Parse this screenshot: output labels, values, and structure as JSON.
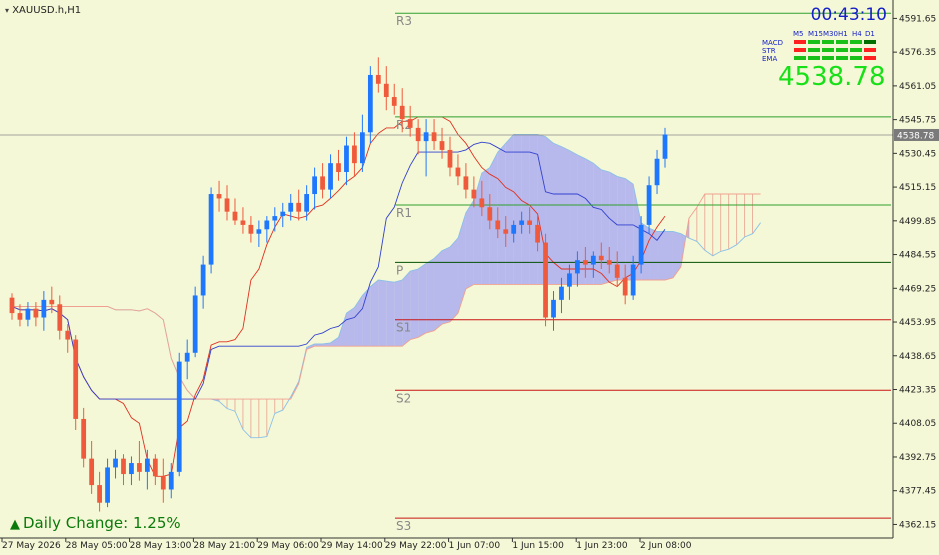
{
  "header": {
    "symbol_label": "XAUUSD.h,H1",
    "timer": "00:43:10",
    "current_price": "4538.78",
    "price_tag": "4538.78"
  },
  "daily_change": {
    "label": "Daily Change:",
    "value": "1.25%"
  },
  "signal_panel": {
    "timeframes": [
      "M5",
      "M15",
      "M30",
      "H1",
      "H4",
      "D1"
    ],
    "rows": [
      {
        "name": "MACD",
        "cells": [
          "#ff2020",
          "#18c018",
          "#18c018",
          "#18c018",
          "#18c018",
          "#007000"
        ]
      },
      {
        "name": "STR",
        "cells": [
          "#ff2020",
          "#18c018",
          "#18c018",
          "#18c018",
          "#18c018",
          "#ff2020"
        ]
      },
      {
        "name": "EMA",
        "cells": [
          "#18c018",
          "#18c018",
          "#18c018",
          "#18c018",
          "#18c018",
          "#ff2020"
        ]
      }
    ]
  },
  "pivots": [
    {
      "name": "R3",
      "price": 4594,
      "color": "#2ea02e"
    },
    {
      "name": "R2",
      "price": 4547,
      "color": "#2ea02e"
    },
    {
      "name": "R1",
      "price": 4507,
      "color": "#2ea02e"
    },
    {
      "name": "P",
      "price": 4481,
      "color": "#005000"
    },
    {
      "name": "S1",
      "price": 4455,
      "color": "#c81414"
    },
    {
      "name": "S2",
      "price": 4423,
      "color": "#c81414"
    },
    {
      "name": "S3",
      "price": 4365,
      "color": "#c81414"
    }
  ],
  "price_axis_ticks": [
    "4591.65",
    "4576.35",
    "4561.05",
    "4545.75",
    "4530.45",
    "4515.15",
    "4499.85",
    "4484.55",
    "4469.25",
    "4453.95",
    "4438.65",
    "4423.35",
    "4408.05",
    "4392.75",
    "4377.45",
    "4362.15"
  ],
  "time_axis_labels": [
    "27 May 2026",
    "28 May 05:00",
    "28 May 13:00",
    "28 May 21:00",
    "29 May 06:00",
    "29 May 14:00",
    "29 May 22:00",
    "1 Jun 07:00",
    "1 Jun 15:00",
    "1 Jun 23:00",
    "2 Jun 08:00"
  ],
  "colors": {
    "bull": "#1e78ff",
    "bear": "#f05a3c",
    "cloud": "#a8a8f0",
    "background": "#f5f8d6"
  },
  "chart_data": {
    "type": "candlestick",
    "ylim": [
      4356,
      4600
    ],
    "current": 4538.78,
    "candles": [
      [
        4465,
        4467,
        4455,
        4458
      ],
      [
        4458,
        4462,
        4452,
        4455
      ],
      [
        4455,
        4463,
        4452,
        4460
      ],
      [
        4460,
        4463,
        4452,
        4456
      ],
      [
        4456,
        4468,
        4450,
        4464
      ],
      [
        4464,
        4470,
        4458,
        4462
      ],
      [
        4462,
        4466,
        4446,
        4450
      ],
      [
        4450,
        4453,
        4440,
        4446
      ],
      [
        4446,
        4448,
        4405,
        4410
      ],
      [
        4410,
        4415,
        4388,
        4392
      ],
      [
        4392,
        4400,
        4376,
        4380
      ],
      [
        4380,
        4386,
        4368,
        4372
      ],
      [
        4372,
        4392,
        4370,
        4388
      ],
      [
        4388,
        4396,
        4383,
        4392
      ],
      [
        4392,
        4394,
        4380,
        4385
      ],
      [
        4385,
        4393,
        4380,
        4390
      ],
      [
        4390,
        4400,
        4382,
        4386
      ],
      [
        4386,
        4396,
        4378,
        4392
      ],
      [
        4392,
        4394,
        4380,
        4384
      ],
      [
        4384,
        4392,
        4372,
        4378
      ],
      [
        4378,
        4390,
        4374,
        4386
      ],
      [
        4386,
        4440,
        4384,
        4436
      ],
      [
        4436,
        4446,
        4428,
        4440
      ],
      [
        4440,
        4470,
        4438,
        4466
      ],
      [
        4466,
        4484,
        4460,
        4480
      ],
      [
        4480,
        4515,
        4476,
        4512
      ],
      [
        4512,
        4518,
        4504,
        4510
      ],
      [
        4510,
        4516,
        4500,
        4504
      ],
      [
        4504,
        4510,
        4498,
        4500
      ],
      [
        4500,
        4506,
        4494,
        4498
      ],
      [
        4498,
        4502,
        4490,
        4494
      ],
      [
        4494,
        4500,
        4488,
        4496
      ],
      [
        4496,
        4502,
        4490,
        4500
      ],
      [
        4500,
        4506,
        4495,
        4502
      ],
      [
        4502,
        4508,
        4497,
        4504
      ],
      [
        4504,
        4512,
        4500,
        4508
      ],
      [
        4508,
        4514,
        4500,
        4504
      ],
      [
        4504,
        4516,
        4500,
        4512
      ],
      [
        4512,
        4524,
        4505,
        4520
      ],
      [
        4520,
        4526,
        4510,
        4514
      ],
      [
        4514,
        4530,
        4510,
        4526
      ],
      [
        4526,
        4532,
        4518,
        4522
      ],
      [
        4522,
        4538,
        4516,
        4534
      ],
      [
        4534,
        4540,
        4520,
        4526
      ],
      [
        4526,
        4548,
        4522,
        4540
      ],
      [
        4540,
        4570,
        4535,
        4566
      ],
      [
        4566,
        4574,
        4558,
        4562
      ],
      [
        4562,
        4570,
        4550,
        4556
      ],
      [
        4556,
        4562,
        4548,
        4552
      ],
      [
        4552,
        4560,
        4540,
        4546
      ],
      [
        4546,
        4552,
        4538,
        4542
      ],
      [
        4542,
        4546,
        4530,
        4536
      ],
      [
        4536,
        4546,
        4520,
        4540
      ],
      [
        4540,
        4546,
        4532,
        4536
      ],
      [
        4536,
        4542,
        4528,
        4532
      ],
      [
        4532,
        4538,
        4520,
        4524
      ],
      [
        4524,
        4530,
        4516,
        4520
      ],
      [
        4520,
        4526,
        4510,
        4514
      ],
      [
        4514,
        4520,
        4506,
        4510
      ],
      [
        4510,
        4518,
        4502,
        4506
      ],
      [
        4506,
        4512,
        4496,
        4500
      ],
      [
        4500,
        4506,
        4492,
        4496
      ],
      [
        4496,
        4502,
        4488,
        4494
      ],
      [
        4494,
        4500,
        4490,
        4498
      ],
      [
        4498,
        4504,
        4494,
        4500
      ],
      [
        4500,
        4506,
        4494,
        4498
      ],
      [
        4498,
        4502,
        4486,
        4490
      ],
      [
        4490,
        4494,
        4452,
        4456
      ],
      [
        4456,
        4468,
        4450,
        4464
      ],
      [
        4464,
        4474,
        4458,
        4470
      ],
      [
        4470,
        4480,
        4464,
        4476
      ],
      [
        4476,
        4486,
        4470,
        4482
      ],
      [
        4482,
        4488,
        4474,
        4480
      ],
      [
        4480,
        4486,
        4474,
        4484
      ],
      [
        4484,
        4490,
        4478,
        4482
      ],
      [
        4482,
        4488,
        4476,
        4480
      ],
      [
        4480,
        4486,
        4470,
        4474
      ],
      [
        4474,
        4480,
        4462,
        4466
      ],
      [
        4466,
        4484,
        4464,
        4480
      ],
      [
        4480,
        4502,
        4476,
        4498
      ],
      [
        4498,
        4520,
        4494,
        4516
      ],
      [
        4516,
        4532,
        4512,
        4528
      ],
      [
        4528,
        4542,
        4524,
        4539
      ]
    ]
  }
}
